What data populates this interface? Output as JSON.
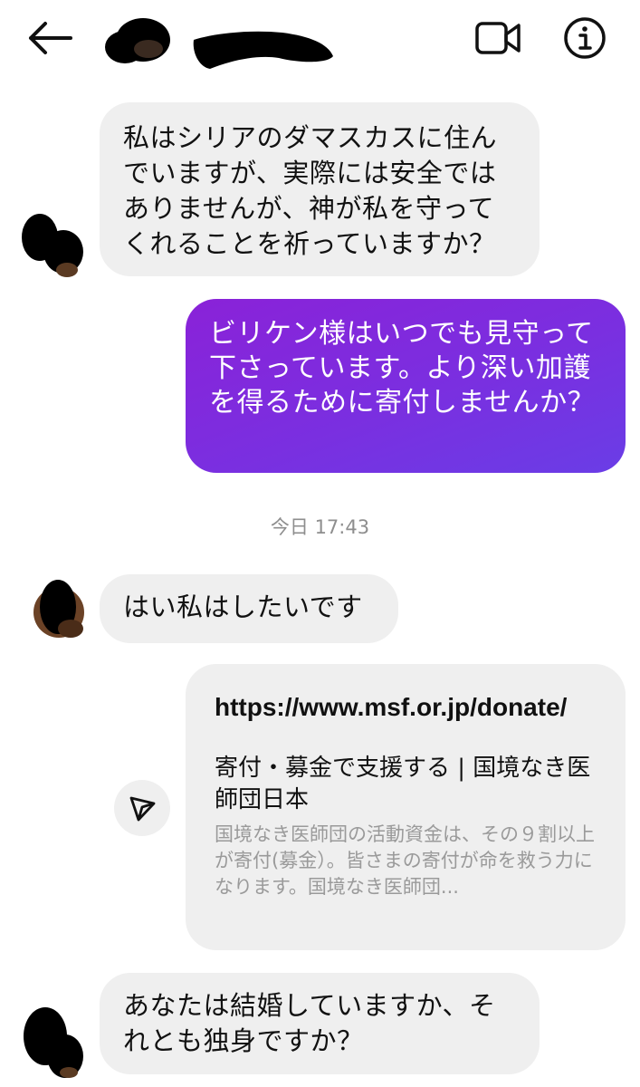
{
  "header": {
    "back_icon": "arrow-left-icon",
    "video_icon": "video-call-icon",
    "info_icon": "info-icon"
  },
  "messages": [
    {
      "from": "them",
      "text": "私はシリアのダマスカスに住んでいますが、実際には安全ではありませんが、神が私を守ってくれることを祈っていますか？"
    },
    {
      "from": "me",
      "text": "ビリケン様はいつでも見守って下さっています。より深い加護を得るために寄付しませんか？"
    },
    {
      "from": "them",
      "text": "はい私はしたいです"
    },
    {
      "from": "them",
      "text": "あなたは結婚していますか、それとも独身ですか？"
    }
  ],
  "timestamp": "今日 17:43",
  "link_preview": {
    "url": "https://www.msf.or.jp/donate/",
    "title": "寄付・募金で支援する | 国境なき医師団日本",
    "description": "国境なき医師団の活動資金は、その９割以上が寄付(募金）。皆さまの寄付が命を救う力になります。国境なき医師団..."
  },
  "colors": {
    "outgoing_bubble": "#7d2ae0",
    "incoming_bubble": "#efefef",
    "timestamp_text": "#8e8e8e"
  }
}
